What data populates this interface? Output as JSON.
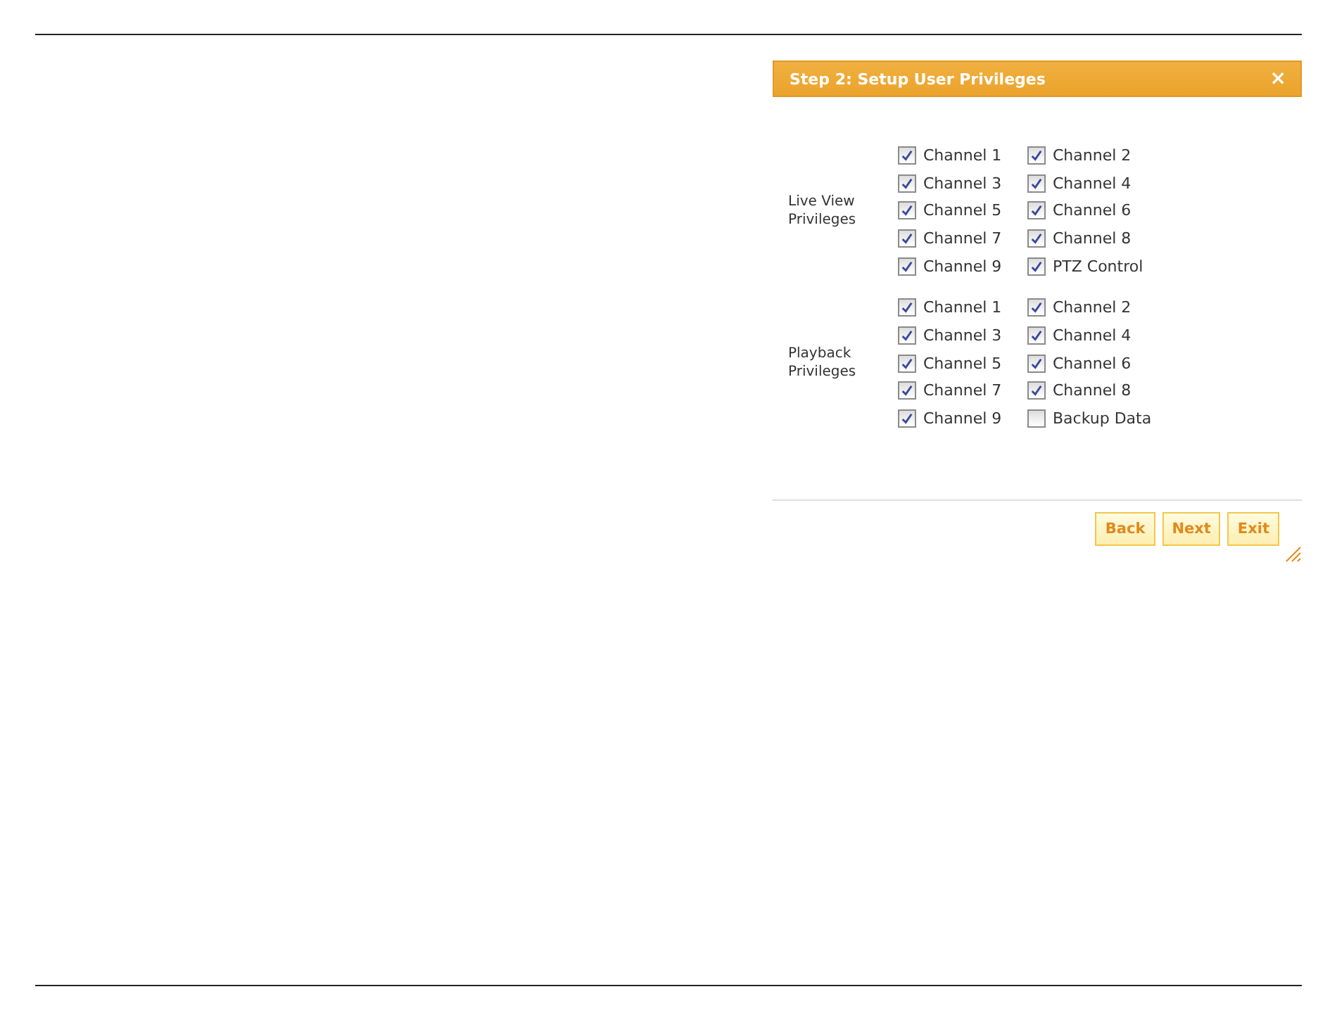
{
  "dialog": {
    "title": "Step 2: Setup User Privileges",
    "close": "×",
    "groups": [
      {
        "label": "Live View Privileges",
        "options": [
          {
            "label": "Channel 1",
            "checked": true
          },
          {
            "label": "Channel 2",
            "checked": true
          },
          {
            "label": "Channel 3",
            "checked": true
          },
          {
            "label": "Channel 4",
            "checked": true
          },
          {
            "label": "Channel 5",
            "checked": true
          },
          {
            "label": "Channel 6",
            "checked": true
          },
          {
            "label": "Channel 7",
            "checked": true
          },
          {
            "label": "Channel 8",
            "checked": true
          },
          {
            "label": "Channel 9",
            "checked": true
          },
          {
            "label": "PTZ Control",
            "checked": true
          }
        ]
      },
      {
        "label": "Playback Privileges",
        "options": [
          {
            "label": "Channel 1",
            "checked": true
          },
          {
            "label": "Channel 2",
            "checked": true
          },
          {
            "label": "Channel 3",
            "checked": true
          },
          {
            "label": "Channel 4",
            "checked": true
          },
          {
            "label": "Channel 5",
            "checked": true
          },
          {
            "label": "Channel 6",
            "checked": true
          },
          {
            "label": "Channel 7",
            "checked": true
          },
          {
            "label": "Channel 8",
            "checked": true
          },
          {
            "label": "Channel 9",
            "checked": true
          },
          {
            "label": "Backup Data",
            "checked": false
          }
        ]
      }
    ],
    "buttons": [
      "Back",
      "Next",
      "Exit"
    ]
  }
}
